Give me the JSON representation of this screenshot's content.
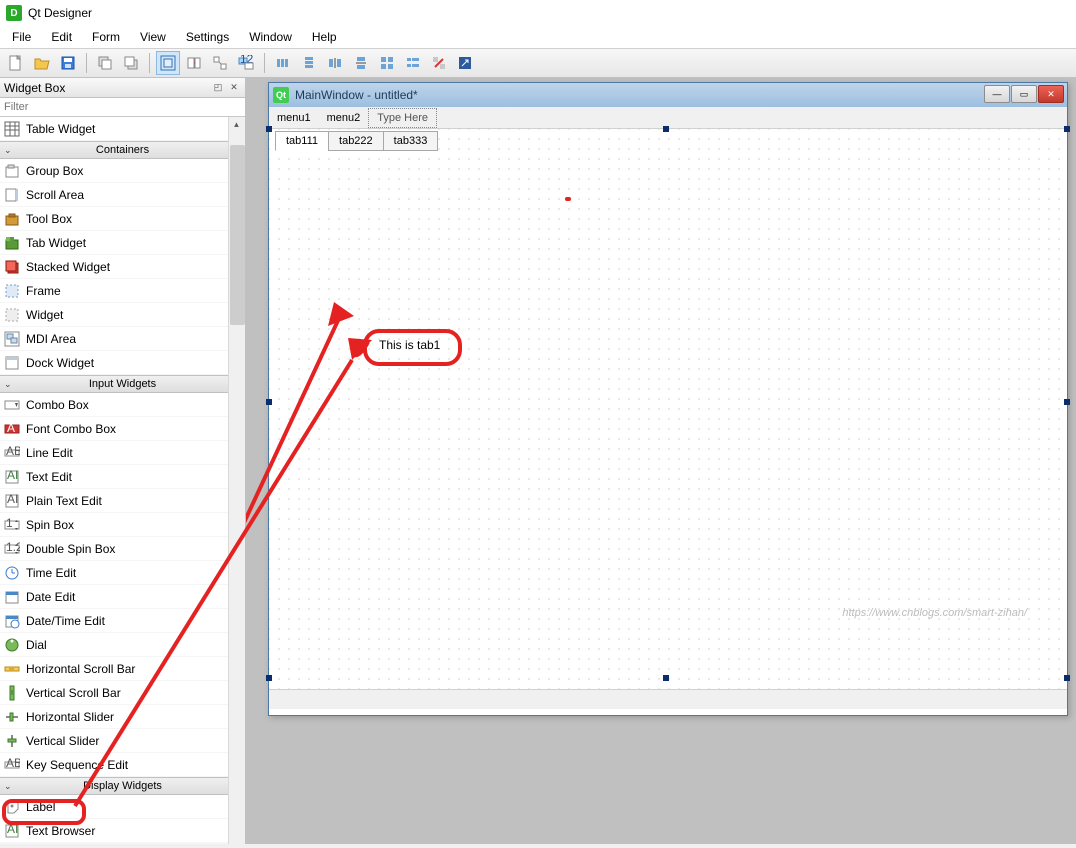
{
  "app": {
    "title": "Qt Designer"
  },
  "menus": [
    "File",
    "Edit",
    "Form",
    "View",
    "Settings",
    "Window",
    "Help"
  ],
  "sidebar": {
    "title": "Widget Box",
    "filterPlaceholder": "Filter",
    "items": [
      {
        "icon": "table",
        "label": "Table Widget"
      },
      {
        "header": "Containers"
      },
      {
        "icon": "group",
        "label": "Group Box"
      },
      {
        "icon": "scroll",
        "label": "Scroll Area"
      },
      {
        "icon": "toolbox",
        "label": "Tool Box"
      },
      {
        "icon": "tabw",
        "label": "Tab Widget"
      },
      {
        "icon": "stack",
        "label": "Stacked Widget"
      },
      {
        "icon": "frame",
        "label": "Frame"
      },
      {
        "icon": "widget",
        "label": "Widget"
      },
      {
        "icon": "mdi",
        "label": "MDI Area"
      },
      {
        "icon": "dock",
        "label": "Dock Widget"
      },
      {
        "header": "Input Widgets"
      },
      {
        "icon": "combo",
        "label": "Combo Box"
      },
      {
        "icon": "fontcombo",
        "label": "Font Combo Box"
      },
      {
        "icon": "lineedit",
        "label": "Line Edit"
      },
      {
        "icon": "textedit",
        "label": "Text Edit"
      },
      {
        "icon": "plain",
        "label": "Plain Text Edit"
      },
      {
        "icon": "spin",
        "label": "Spin Box"
      },
      {
        "icon": "dspin",
        "label": "Double Spin Box"
      },
      {
        "icon": "time",
        "label": "Time Edit"
      },
      {
        "icon": "date",
        "label": "Date Edit"
      },
      {
        "icon": "datetime",
        "label": "Date/Time Edit"
      },
      {
        "icon": "dial",
        "label": "Dial"
      },
      {
        "icon": "hscroll",
        "label": "Horizontal Scroll Bar"
      },
      {
        "icon": "vscroll",
        "label": "Vertical Scroll Bar"
      },
      {
        "icon": "hslider",
        "label": "Horizontal Slider"
      },
      {
        "icon": "vslider",
        "label": "Vertical Slider"
      },
      {
        "icon": "keyseq",
        "label": "Key Sequence Edit"
      },
      {
        "header": "Display Widgets"
      },
      {
        "icon": "label",
        "label": "Label"
      },
      {
        "icon": "textbr",
        "label": "Text Browser"
      }
    ]
  },
  "subwindow": {
    "title": "MainWindow - untitled*",
    "menus": [
      "menu1",
      "menu2"
    ],
    "typeHere": "Type Here",
    "tabs": [
      "tab111",
      "tab222",
      "tab333"
    ],
    "labelText": "This is tab1"
  },
  "watermark": "https://www.cnblogs.com/smart-zihan/"
}
